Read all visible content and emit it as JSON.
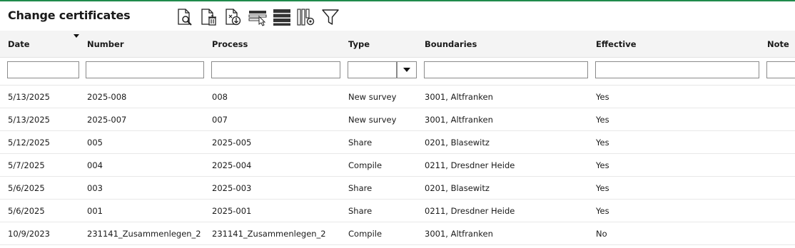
{
  "page": {
    "title": "Change certificates",
    "accent": "#1f8a4c"
  },
  "toolbar": {
    "buttons": [
      {
        "name": "view-document-icon"
      },
      {
        "name": "delete-document-icon"
      },
      {
        "name": "download-document-icon"
      },
      {
        "name": "select-rows-icon"
      },
      {
        "name": "rows-list-icon"
      },
      {
        "name": "column-settings-icon"
      },
      {
        "name": "filter-icon"
      }
    ]
  },
  "columns": [
    "Date",
    "Number",
    "Process",
    "Type",
    "Boundaries",
    "Effective",
    "Note"
  ],
  "rows": [
    [
      "5/13/2025",
      "2025-008",
      "008",
      "New survey",
      "3001, Altfranken",
      "Yes",
      ""
    ],
    [
      "5/13/2025",
      "2025-007",
      "007",
      "New survey",
      "3001, Altfranken",
      "Yes",
      ""
    ],
    [
      "5/12/2025",
      "005",
      "2025-005",
      "Share",
      "0201, Blasewitz",
      "Yes",
      ""
    ],
    [
      "5/7/2025",
      "004",
      "2025-004",
      "Compile",
      "0211, Dresdner Heide",
      "Yes",
      ""
    ],
    [
      "5/6/2025",
      "003",
      "2025-003",
      "Share",
      "0201, Blasewitz",
      "Yes",
      ""
    ],
    [
      "5/6/2025",
      "001",
      "2025-001",
      "Share",
      "0211, Dresdner Heide",
      "Yes",
      ""
    ],
    [
      "10/9/2023",
      "231141_Zusammenlegen_2",
      "231141_Zusammenlegen_2",
      "Compile",
      "3001, Altfranken",
      "No",
      ""
    ]
  ]
}
